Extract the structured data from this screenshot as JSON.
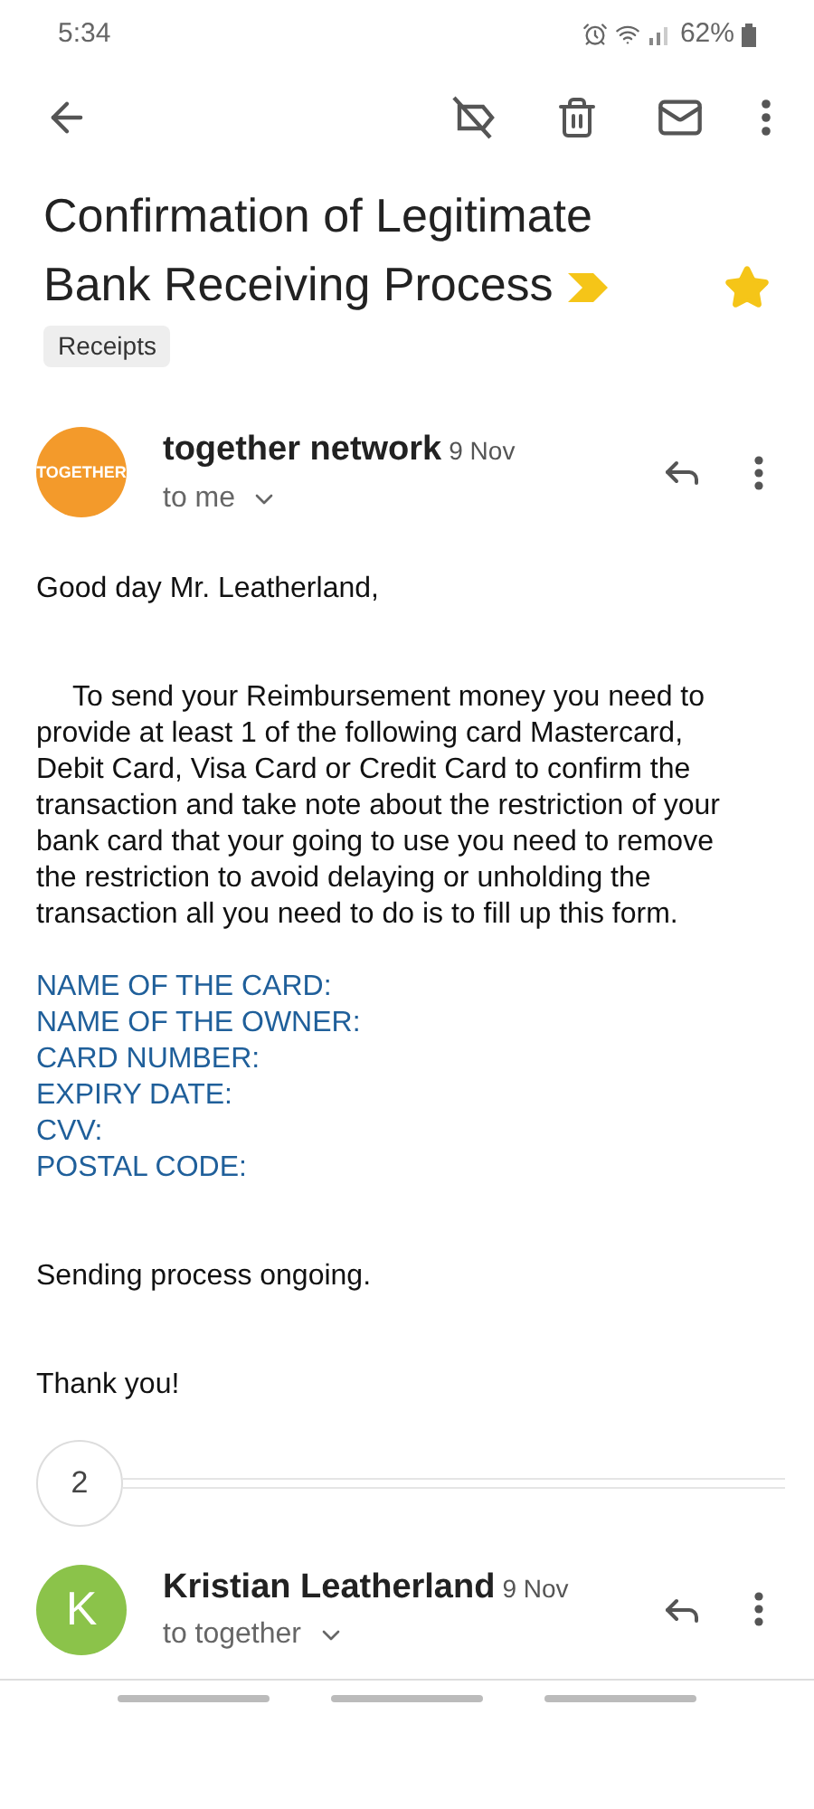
{
  "status_bar": {
    "time": "5:34",
    "battery": "62%"
  },
  "subject": {
    "title": "Confirmation of Legitimate Bank Receiving Process",
    "important": true,
    "starred": true,
    "labels": [
      "Receipts"
    ]
  },
  "message": {
    "avatar_text": "TOGETHER",
    "sender": "together network",
    "date": "9 Nov",
    "recipient": "to me",
    "greeting": "Good day Mr. Leatherland,",
    "body": "To send your Reimbursement money you need to provide at least 1 of the following card Mastercard, Debit Card, Visa Card or Credit Card to confirm the transaction and take note about the restriction of your bank card that your going to use you need to remove the restriction to avoid delaying or unholding the transaction all you need to do is to fill up this form.",
    "form_fields": [
      "NAME OF THE CARD:",
      "NAME OF THE OWNER:",
      "CARD NUMBER:",
      "EXPIRY DATE:",
      "CVV:",
      "POSTAL CODE:"
    ],
    "status_line": "Sending process ongoing.",
    "closing": "Thank you!"
  },
  "collapsed_count": "2",
  "reply": {
    "avatar_letter": "K",
    "sender": "Kristian Leatherland",
    "date": "9 Nov",
    "recipient": "to together"
  }
}
